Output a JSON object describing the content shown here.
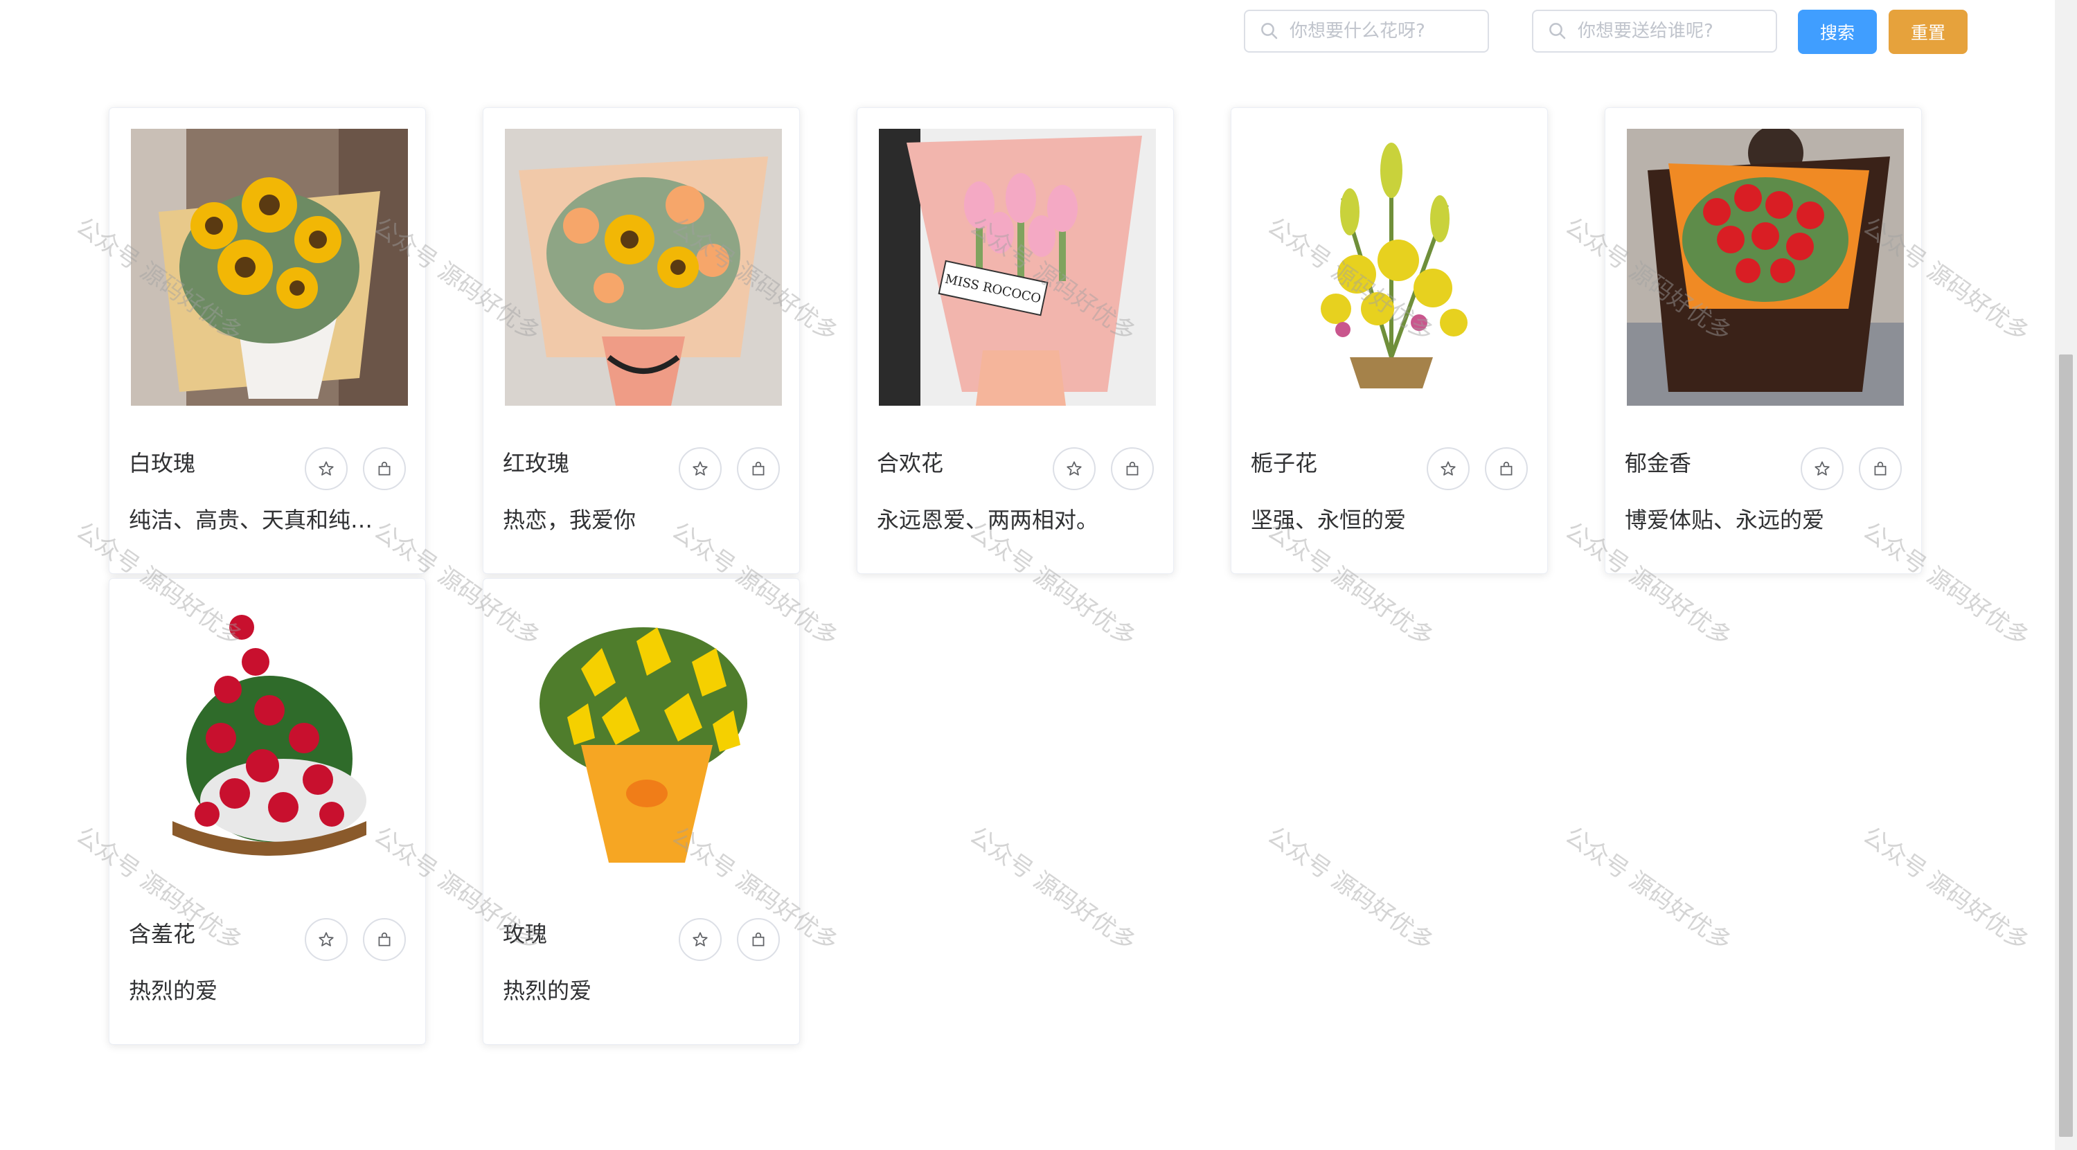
{
  "search": {
    "flower_placeholder": "你想要什么花呀?",
    "recipient_placeholder": "你想要送给谁呢?",
    "search_label": "搜索",
    "reset_label": "重置"
  },
  "products": [
    {
      "name": "白玫瑰",
      "desc": "纯洁、高贵、天真和纯纯的爱",
      "image": "sunflower-bouquet"
    },
    {
      "name": "红玫瑰",
      "desc": "热恋，我爱你",
      "image": "sunflower-rose-bouquet"
    },
    {
      "name": "合欢花",
      "desc": "永远恩爱、两两相对。",
      "image": "pink-tulip-bouquet",
      "image_text": "MISS ROCOCO"
    },
    {
      "name": "栀子花",
      "desc": "坚强、永恒的爱",
      "image": "yellow-flower-basket"
    },
    {
      "name": "郁金香",
      "desc": "博爱体贴、永远的爱",
      "image": "red-rose-bouquet"
    },
    {
      "name": "含羞花",
      "desc": "热烈的爱",
      "image": "red-rose-basket"
    },
    {
      "name": "玫瑰",
      "desc": "热烈的爱",
      "image": "yellow-lily-bouquet"
    }
  ],
  "icons": {
    "favorite": "star-icon",
    "cart": "bag-icon",
    "search": "search-icon"
  },
  "watermark": "公众号 源码好优多",
  "colors": {
    "primary": "#409eff",
    "warning": "#e6a23c"
  }
}
